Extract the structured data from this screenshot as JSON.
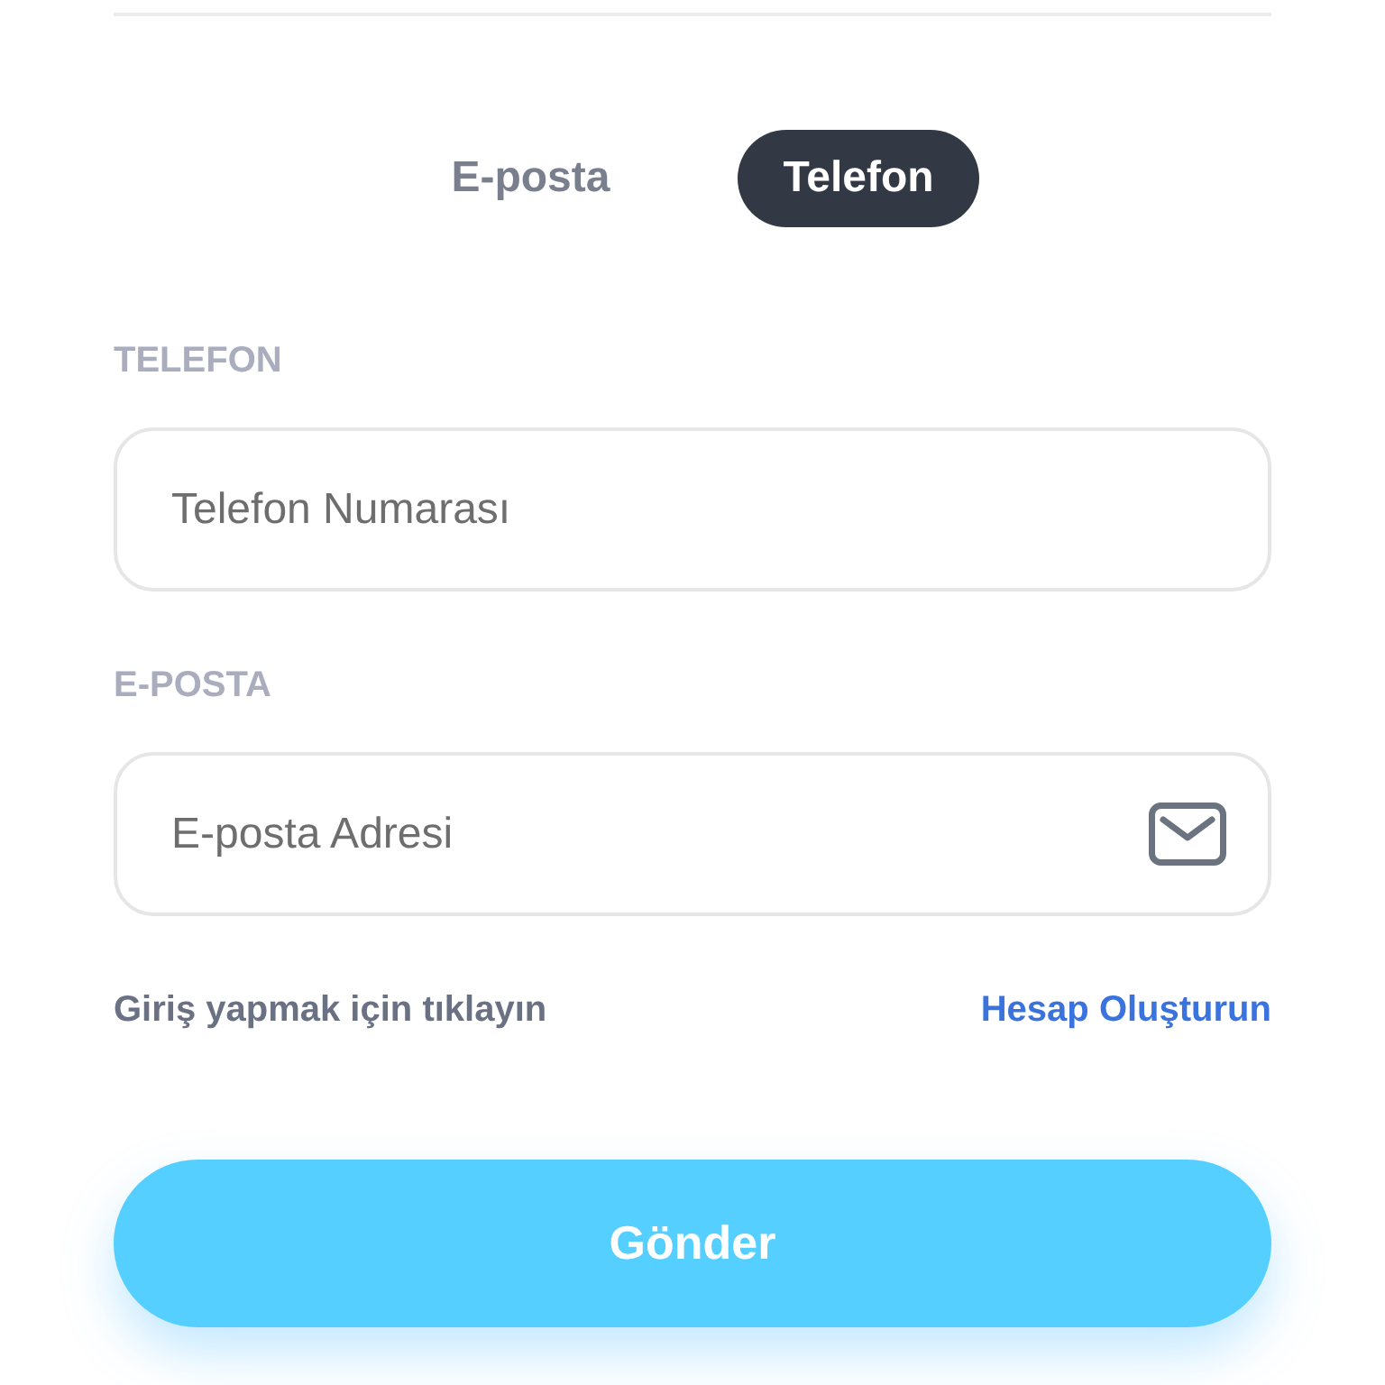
{
  "tabs": [
    {
      "label": "E-posta",
      "selected": false
    },
    {
      "label": "Telefon",
      "selected": true
    }
  ],
  "fields": [
    {
      "kind": "phone",
      "label": "TELEFON",
      "placeholder": "Telefon Numarası"
    },
    {
      "kind": "email",
      "label": "E-POSTA",
      "placeholder": "E-posta Adresi"
    }
  ],
  "links": {
    "login": "Giriş yapmak için tıklayın",
    "signup": "Hesap Oluşturun"
  },
  "submit_button": {
    "label": "Gönder"
  }
}
